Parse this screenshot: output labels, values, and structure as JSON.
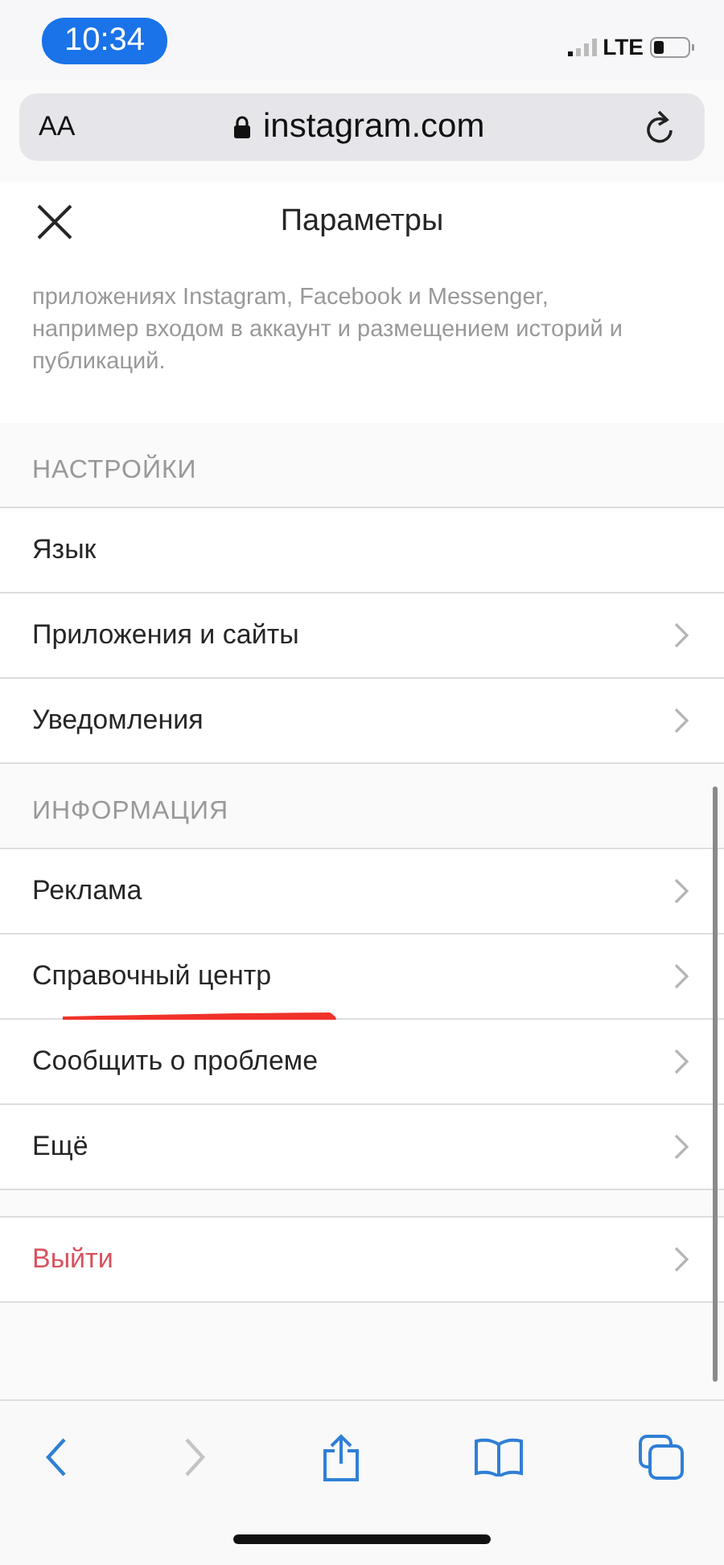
{
  "status_bar": {
    "time": "10:34",
    "network": "LTE"
  },
  "address_bar": {
    "text_size_button": "AA",
    "url": "instagram.com"
  },
  "header": {
    "title": "Параметры"
  },
  "description": "приложениях Instagram, Facebook и Messenger, например входом в аккаунт и размещением историй и публикаций.",
  "sections": [
    {
      "title": "НАСТРОЙКИ",
      "items": [
        {
          "label": "Язык",
          "chevron": false,
          "destructive": false,
          "underlined": false
        },
        {
          "label": "Приложения и сайты",
          "chevron": true,
          "destructive": false,
          "underlined": false
        },
        {
          "label": "Уведомления",
          "chevron": true,
          "destructive": false,
          "underlined": false
        }
      ]
    },
    {
      "title": "ИНФОРМАЦИЯ",
      "items": [
        {
          "label": "Реклама",
          "chevron": true,
          "destructive": false,
          "underlined": false
        },
        {
          "label": "Справочный центр",
          "chevron": true,
          "destructive": false,
          "underlined": true
        },
        {
          "label": "Сообщить о проблеме",
          "chevron": true,
          "destructive": false,
          "underlined": false
        },
        {
          "label": "Ещё",
          "chevron": true,
          "destructive": false,
          "underlined": false
        }
      ]
    },
    {
      "items": [
        {
          "label": "Выйти",
          "chevron": true,
          "destructive": true,
          "underlined": false
        }
      ]
    }
  ],
  "toolbar": {
    "back_enabled": true,
    "forward_enabled": false
  }
}
